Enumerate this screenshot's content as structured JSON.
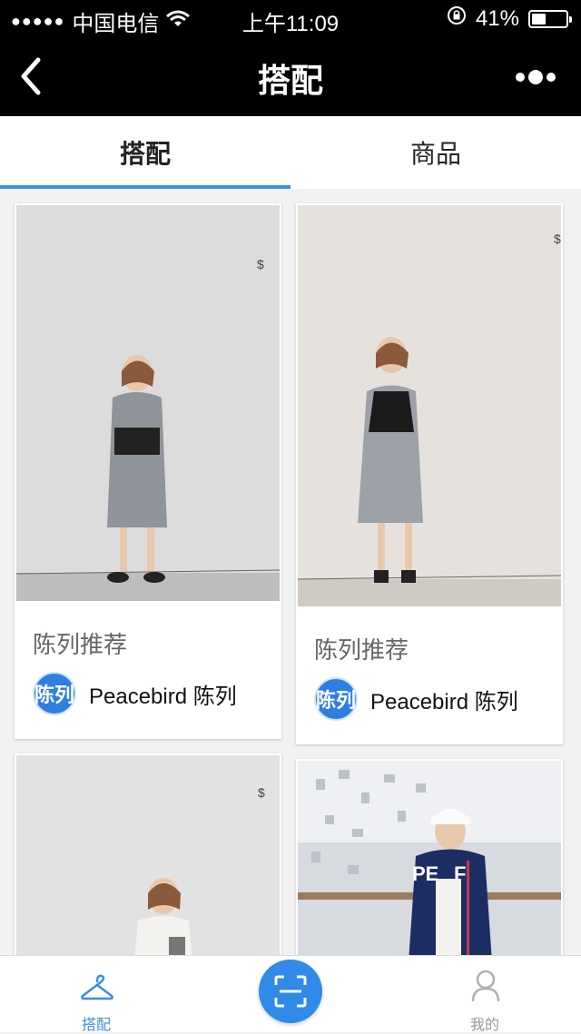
{
  "status_bar": {
    "signal_dots": "●●●●●",
    "carrier": "中国电信",
    "time": "上午11:09",
    "battery": "41%",
    "battery_level": 0.41
  },
  "nav": {
    "title": "搭配",
    "back_icon": "back-chevron-icon",
    "more_icon": "more-dots-icon"
  },
  "tabs": [
    {
      "label": "搭配",
      "active": true
    },
    {
      "label": "商品",
      "active": false
    }
  ],
  "cards": [
    {
      "title": "陈列推荐",
      "avatar_text": "陈列",
      "author": "Peacebird 陈列"
    },
    {
      "title": "陈列推荐",
      "avatar_text": "陈列",
      "author": "Peacebird 陈列"
    }
  ],
  "bottom_nav": {
    "items": [
      {
        "label": "搭配",
        "icon": "hanger-icon",
        "active": true
      },
      {
        "label": "",
        "icon": "scan-icon",
        "active": false
      },
      {
        "label": "我的",
        "icon": "user-icon",
        "active": false
      }
    ]
  },
  "colors": {
    "accent": "#3a8de6",
    "nav_background": "#000000",
    "inactive": "#999999"
  }
}
